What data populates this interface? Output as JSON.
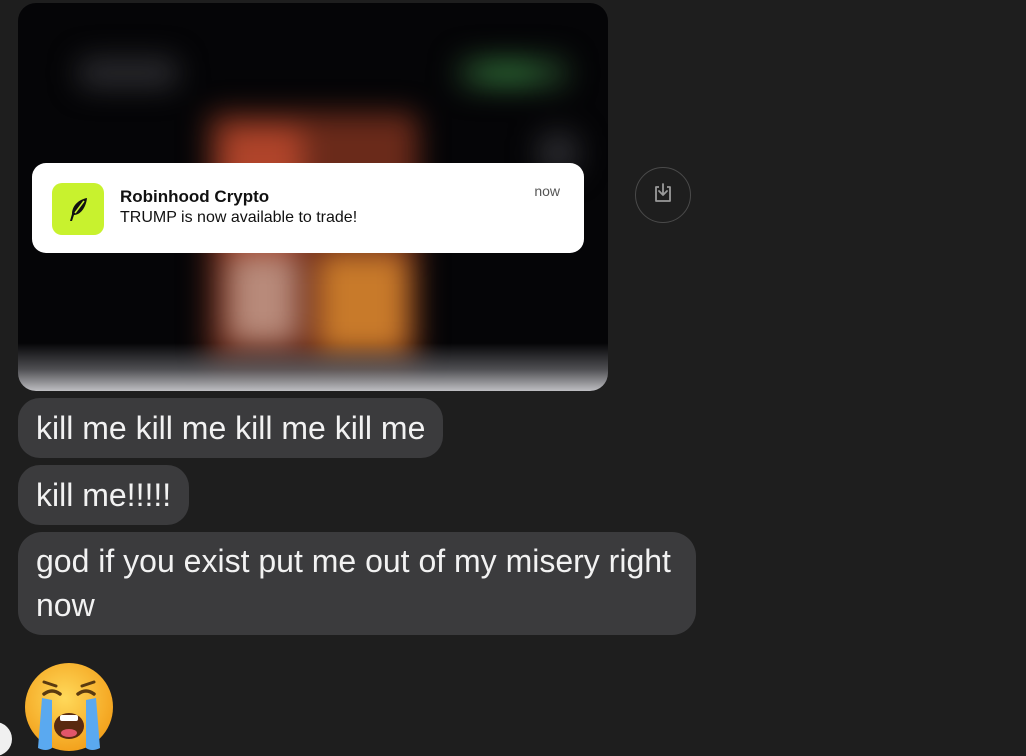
{
  "attachment": {
    "notification": {
      "app_name": "Robinhood Crypto",
      "message": "TRUMP is now available to trade!",
      "time": "now",
      "app_icon": "feather-icon",
      "app_icon_color": "#c8f22e"
    },
    "download_icon": "download-icon"
  },
  "messages": [
    {
      "text": "kill me kill me kill me kill me"
    },
    {
      "text": "kill me!!!!!"
    },
    {
      "text": "god if you exist put me out of my misery right now"
    }
  ],
  "reaction": {
    "icon": "loudly-crying-face-emoji"
  },
  "colors": {
    "background": "#1e1e1e",
    "bubble": "#3b3b3d",
    "bubble_text": "#f2f2f2"
  }
}
